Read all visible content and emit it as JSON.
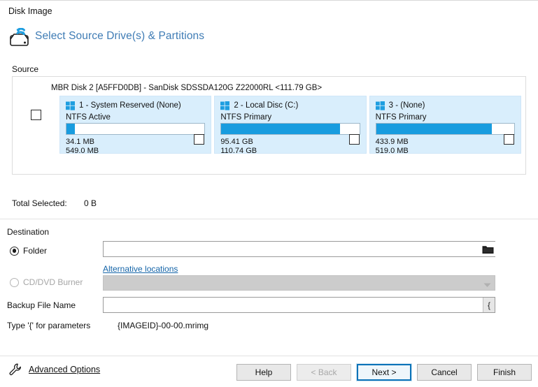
{
  "window": {
    "title": "Disk Image"
  },
  "header": {
    "icon": "disk-image-refresh-icon",
    "title": "Select Source Drive(s) & Partitions"
  },
  "source": {
    "group_label": "Source",
    "disk_label": "MBR Disk 2 [A5FFD0DB] - SanDisk SDSSDA120G Z22000RL  <111.79 GB>",
    "disk_checkbox_checked": false,
    "partitions": [
      {
        "icon": "windows-logo-icon",
        "name": "1 - System Reserved (None)",
        "filesystem": "NTFS Active",
        "used": "34.1 MB",
        "total": "549.0 MB",
        "fill_percent": 6,
        "checkbox_checked": false
      },
      {
        "icon": "windows-logo-icon",
        "name": "2 - Local Disc (C:)",
        "filesystem": "NTFS Primary",
        "used": "95.41 GB",
        "total": "110.74 GB",
        "fill_percent": 86,
        "checkbox_checked": false
      },
      {
        "icon": "windows-logo-icon",
        "name": "3 -  (None)",
        "filesystem": "NTFS Primary",
        "used": "433.9 MB",
        "total": "519.0 MB",
        "fill_percent": 84,
        "checkbox_checked": false
      }
    ]
  },
  "total_selected": {
    "label": "Total Selected:",
    "value": "0 B"
  },
  "destination": {
    "group_label": "Destination",
    "folder": {
      "radio_label": "Folder",
      "selected": true,
      "value": "",
      "placeholder": "",
      "chevron_icon": "chevron-down-icon",
      "browse_icon": "folder-icon"
    },
    "alternative_locations_link": "Alternative locations",
    "cd_dvd": {
      "radio_label": "CD/DVD Burner",
      "selected": false,
      "disabled": true,
      "value": "",
      "chevron_icon": "chevron-down-icon"
    },
    "backup_file_name": {
      "label": "Backup File Name",
      "value": "",
      "placeholder": "",
      "brace_button_label": "{"
    },
    "type_hint": {
      "label": "Type '{' for parameters",
      "pattern": "{IMAGEID}-00-00.mrimg"
    }
  },
  "footer": {
    "advanced_options": {
      "label": "Advanced Options",
      "icon": "wrench-icon"
    },
    "buttons": [
      {
        "label": "Help",
        "state": "enabled"
      },
      {
        "label": "< Back",
        "state": "disabled"
      },
      {
        "label": "Next >",
        "state": "default"
      },
      {
        "label": "Cancel",
        "state": "enabled"
      },
      {
        "label": "Finish",
        "state": "enabled"
      }
    ]
  },
  "colors": {
    "accent_blue": "#189cdf",
    "link_blue": "#1464a8",
    "header_title_blue": "#3f7cb5",
    "panel_blue": "#d9eefc",
    "default_button_border": "#0a72b8"
  }
}
